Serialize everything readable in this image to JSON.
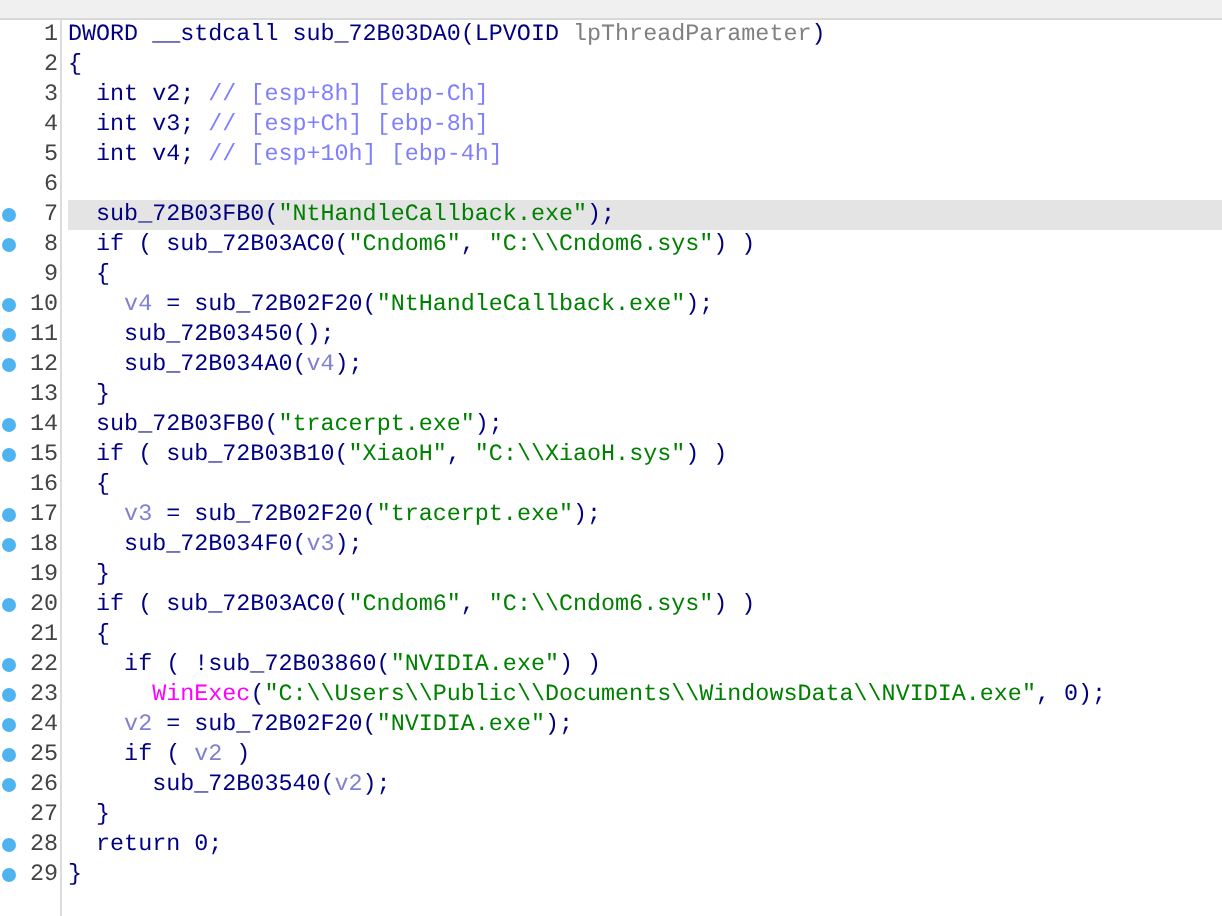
{
  "code_view": {
    "lines": [
      {
        "number": "1",
        "breakpoint": false,
        "selected": false,
        "tokens": [
          {
            "text": "DWORD __stdcall sub_72B03DA0(LPVOID ",
            "kind": "text"
          },
          {
            "text": "lpThreadParameter",
            "kind": "arg"
          },
          {
            "text": ")",
            "kind": "text"
          }
        ]
      },
      {
        "number": "2",
        "breakpoint": false,
        "selected": false,
        "tokens": [
          {
            "text": "{",
            "kind": "text"
          }
        ]
      },
      {
        "number": "3",
        "breakpoint": false,
        "selected": false,
        "tokens": [
          {
            "text": "  int v2; ",
            "kind": "text"
          },
          {
            "text": "// [esp+8h] [ebp-Ch]",
            "kind": "comment"
          }
        ]
      },
      {
        "number": "4",
        "breakpoint": false,
        "selected": false,
        "tokens": [
          {
            "text": "  int v3; ",
            "kind": "text"
          },
          {
            "text": "// [esp+Ch] [ebp-8h]",
            "kind": "comment"
          }
        ]
      },
      {
        "number": "5",
        "breakpoint": false,
        "selected": false,
        "tokens": [
          {
            "text": "  int v4; ",
            "kind": "text"
          },
          {
            "text": "// [esp+10h] [ebp-4h]",
            "kind": "comment"
          }
        ]
      },
      {
        "number": "6",
        "breakpoint": false,
        "selected": false
      },
      {
        "number": "7",
        "breakpoint": true,
        "selected": true,
        "tokens": [
          {
            "text": "  sub_72B03FB0(",
            "kind": "text"
          },
          {
            "text": "\"NtHandleCallback.exe\"",
            "kind": "string"
          },
          {
            "text": ");",
            "kind": "text"
          }
        ]
      },
      {
        "number": "8",
        "breakpoint": true,
        "selected": false,
        "tokens": [
          {
            "text": "  if ( sub_72B03AC0(",
            "kind": "text"
          },
          {
            "text": "\"Cndom6\"",
            "kind": "string"
          },
          {
            "text": ", ",
            "kind": "text"
          },
          {
            "text": "\"C:\\\\Cndom6.sys\"",
            "kind": "string"
          },
          {
            "text": ") )",
            "kind": "text"
          }
        ]
      },
      {
        "number": "9",
        "breakpoint": false,
        "selected": false,
        "tokens": [
          {
            "text": "  {",
            "kind": "text"
          }
        ]
      },
      {
        "number": "10",
        "breakpoint": true,
        "selected": false,
        "tokens": [
          {
            "text": "    v4",
            "kind": "var"
          },
          {
            "text": " = sub_72B02F20(",
            "kind": "text"
          },
          {
            "text": "\"NtHandleCallback.exe\"",
            "kind": "string"
          },
          {
            "text": ");",
            "kind": "text"
          }
        ]
      },
      {
        "number": "11",
        "breakpoint": true,
        "selected": false,
        "tokens": [
          {
            "text": "    sub_72B03450();",
            "kind": "text"
          }
        ]
      },
      {
        "number": "12",
        "breakpoint": true,
        "selected": false,
        "tokens": [
          {
            "text": "    sub_72B034A0(",
            "kind": "text"
          },
          {
            "text": "v4",
            "kind": "var"
          },
          {
            "text": ");",
            "kind": "text"
          }
        ]
      },
      {
        "number": "13",
        "breakpoint": false,
        "selected": false,
        "tokens": [
          {
            "text": "  }",
            "kind": "text"
          }
        ]
      },
      {
        "number": "14",
        "breakpoint": true,
        "selected": false,
        "tokens": [
          {
            "text": "  sub_72B03FB0(",
            "kind": "text"
          },
          {
            "text": "\"tracerpt.exe\"",
            "kind": "string"
          },
          {
            "text": ");",
            "kind": "text"
          }
        ]
      },
      {
        "number": "15",
        "breakpoint": true,
        "selected": false,
        "tokens": [
          {
            "text": "  if ( sub_72B03B10(",
            "kind": "text"
          },
          {
            "text": "\"XiaoH\"",
            "kind": "string"
          },
          {
            "text": ", ",
            "kind": "text"
          },
          {
            "text": "\"C:\\\\XiaoH.sys\"",
            "kind": "string"
          },
          {
            "text": ") )",
            "kind": "text"
          }
        ]
      },
      {
        "number": "16",
        "breakpoint": false,
        "selected": false,
        "tokens": [
          {
            "text": "  {",
            "kind": "text"
          }
        ]
      },
      {
        "number": "17",
        "breakpoint": true,
        "selected": false,
        "tokens": [
          {
            "text": "    v3",
            "kind": "var"
          },
          {
            "text": " = sub_72B02F20(",
            "kind": "text"
          },
          {
            "text": "\"tracerpt.exe\"",
            "kind": "string"
          },
          {
            "text": ");",
            "kind": "text"
          }
        ]
      },
      {
        "number": "18",
        "breakpoint": true,
        "selected": false,
        "tokens": [
          {
            "text": "    sub_72B034F0(",
            "kind": "text"
          },
          {
            "text": "v3",
            "kind": "var"
          },
          {
            "text": ");",
            "kind": "text"
          }
        ]
      },
      {
        "number": "19",
        "breakpoint": false,
        "selected": false,
        "tokens": [
          {
            "text": "  }",
            "kind": "text"
          }
        ]
      },
      {
        "number": "20",
        "breakpoint": true,
        "selected": false,
        "tokens": [
          {
            "text": "  if ( sub_72B03AC0(",
            "kind": "text"
          },
          {
            "text": "\"Cndom6\"",
            "kind": "string"
          },
          {
            "text": ", ",
            "kind": "text"
          },
          {
            "text": "\"C:\\\\Cndom6.sys\"",
            "kind": "string"
          },
          {
            "text": ") )",
            "kind": "text"
          }
        ]
      },
      {
        "number": "21",
        "breakpoint": false,
        "selected": false,
        "tokens": [
          {
            "text": "  {",
            "kind": "text"
          }
        ]
      },
      {
        "number": "22",
        "breakpoint": true,
        "selected": false,
        "tokens": [
          {
            "text": "    if ( !sub_72B03860(",
            "kind": "text"
          },
          {
            "text": "\"NVIDIA.exe\"",
            "kind": "string"
          },
          {
            "text": ") )",
            "kind": "text"
          }
        ]
      },
      {
        "number": "23",
        "breakpoint": true,
        "selected": false,
        "tokens": [
          {
            "text": "      WinExec",
            "kind": "import"
          },
          {
            "text": "(",
            "kind": "text"
          },
          {
            "text": "\"C:\\\\Users\\\\Public\\\\Documents\\\\WindowsData\\\\NVIDIA.exe\"",
            "kind": "string"
          },
          {
            "text": ", 0);",
            "kind": "text"
          }
        ]
      },
      {
        "number": "24",
        "breakpoint": true,
        "selected": false,
        "tokens": [
          {
            "text": "    v2",
            "kind": "var"
          },
          {
            "text": " = sub_72B02F20(",
            "kind": "text"
          },
          {
            "text": "\"NVIDIA.exe\"",
            "kind": "string"
          },
          {
            "text": ");",
            "kind": "text"
          }
        ]
      },
      {
        "number": "25",
        "breakpoint": true,
        "selected": false,
        "tokens": [
          {
            "text": "    if ( ",
            "kind": "text"
          },
          {
            "text": "v2",
            "kind": "var"
          },
          {
            "text": " )",
            "kind": "text"
          }
        ]
      },
      {
        "number": "26",
        "breakpoint": true,
        "selected": false,
        "tokens": [
          {
            "text": "      sub_72B03540(",
            "kind": "text"
          },
          {
            "text": "v2",
            "kind": "var"
          },
          {
            "text": ");",
            "kind": "text"
          }
        ]
      },
      {
        "number": "27",
        "breakpoint": false,
        "selected": false,
        "tokens": [
          {
            "text": "  }",
            "kind": "text"
          }
        ]
      },
      {
        "number": "28",
        "breakpoint": true,
        "selected": false,
        "tokens": [
          {
            "text": "  return 0;",
            "kind": "text"
          }
        ]
      },
      {
        "number": "29",
        "breakpoint": true,
        "selected": false,
        "tokens": [
          {
            "text": "}",
            "kind": "text"
          }
        ]
      }
    ]
  }
}
